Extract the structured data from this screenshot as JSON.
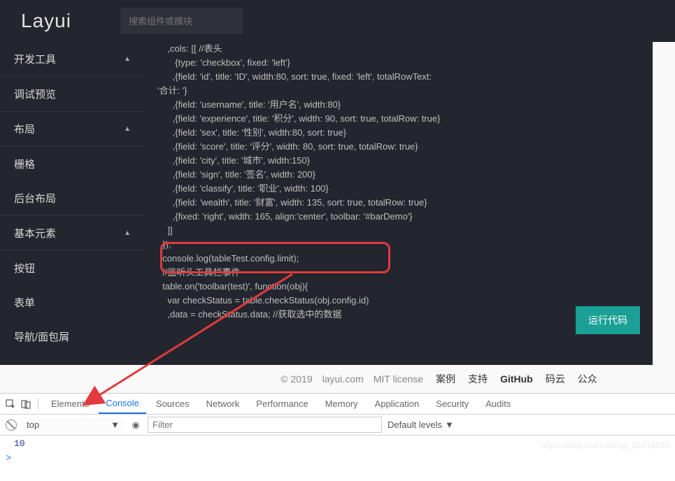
{
  "header": {
    "logo": "Layui",
    "search_placeholder": "搜索组件或模块"
  },
  "sidebar": {
    "items": [
      {
        "label": "开发工具",
        "parent": true,
        "expanded": true
      },
      {
        "label": "调试预览"
      },
      {
        "label": "布局",
        "parent": true,
        "expanded": true
      },
      {
        "label": "栅格"
      },
      {
        "label": "后台布局"
      },
      {
        "label": "基本元素",
        "parent": true,
        "expanded": true
      },
      {
        "label": "按钮"
      },
      {
        "label": "表单"
      },
      {
        "label": "导航/面包屑"
      }
    ]
  },
  "code": {
    "lines": [
      "    ,cols: [[ //表头",
      "       {type: 'checkbox', fixed: 'left'}",
      "      ,{field: 'id', title: 'ID', width:80, sort: true, fixed: 'left', totalRowText:",
      "'合计: '}",
      "      ,{field: 'username', title: '用户名', width:80}",
      "      ,{field: 'experience', title: '积分', width: 90, sort: true, totalRow: true}",
      "      ,{field: 'sex', title: '性别', width:80, sort: true}",
      "      ,{field: 'score', title: '评分', width: 80, sort: true, totalRow: true}",
      "      ,{field: 'city', title: '城市', width:150}",
      "      ,{field: 'sign', title: '签名', width: 200}",
      "      ,{field: 'classify', title: '职业', width: 100}",
      "      ,{field: 'wealth', title: '财富', width: 135, sort: true, totalRow: true}",
      "      ,{fixed: 'right', width: 165, align:'center', toolbar: '#barDemo'}",
      "    ]]",
      "  });",
      "  console.log(tableTest.config.limit);",
      "  //监听头工具栏事件",
      "  table.on('toolbar(test)', function(obj){",
      "    var checkStatus = table.checkStatus(obj.config.id)",
      "    ,data = checkStatus.data; //获取选中的数据"
    ],
    "run_button": "运行代码"
  },
  "footer": {
    "copyright": "© 2019",
    "site": "layui.com",
    "license": "MIT license",
    "links": [
      "案例",
      "支持",
      "GitHub",
      "码云",
      "公众"
    ]
  },
  "devtools": {
    "tabs": [
      "Elements",
      "Console",
      "Sources",
      "Network",
      "Performance",
      "Memory",
      "Application",
      "Security",
      "Audits"
    ],
    "active_tab": "Console",
    "context": "top",
    "filter_placeholder": "Filter",
    "levels": "Default levels",
    "output": "10",
    "prompt": ">"
  },
  "watermark": "https://blog.csdn.net/qq_26818839"
}
